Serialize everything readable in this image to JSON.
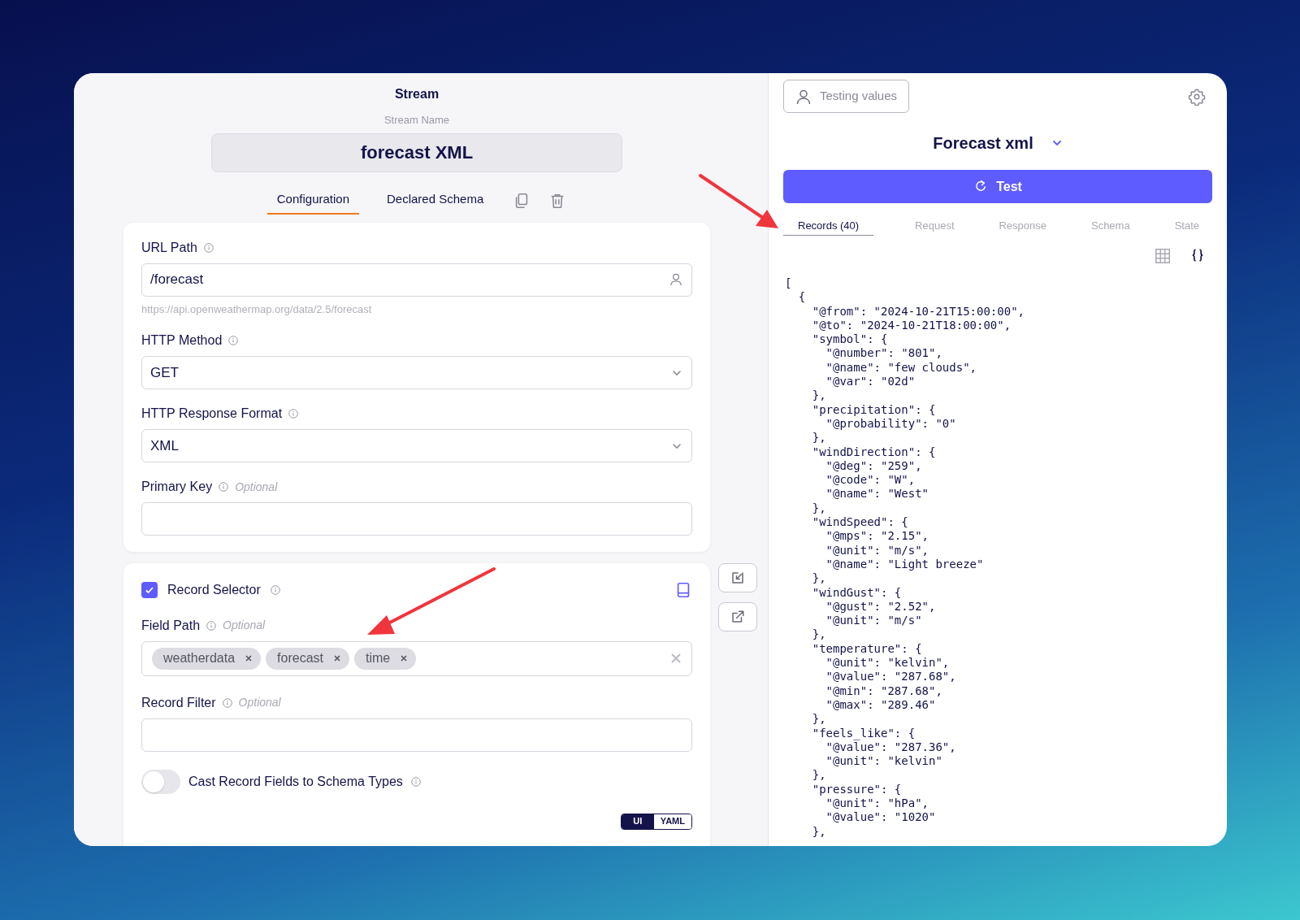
{
  "stream": {
    "heading": "Stream",
    "name_label": "Stream Name",
    "name": "forecast XML"
  },
  "tabs": [
    {
      "label": "Configuration",
      "selected": true
    },
    {
      "label": "Declared Schema",
      "selected": false
    }
  ],
  "config_fields": [
    {
      "kind": "text",
      "label": "URL Path",
      "value": "/forecast",
      "hint": "https://api.openweathermap.org/data/2.5/forecast"
    },
    {
      "kind": "select",
      "label": "HTTP Method",
      "value": "GET"
    },
    {
      "kind": "select",
      "label": "HTTP Response Format",
      "value": "XML"
    },
    {
      "kind": "text",
      "label": "Primary Key",
      "optional": "Optional"
    }
  ],
  "record_selector": {
    "label": "Record Selector",
    "checked": true,
    "field_path": {
      "label": "Field Path",
      "optional": "Optional",
      "tags": [
        "weatherdata",
        "forecast",
        "time"
      ]
    },
    "record_filter": {
      "label": "Record Filter",
      "optional": "Optional"
    },
    "cast_toggle": {
      "label": "Cast Record Fields to Schema Types",
      "on": false
    },
    "mode_switch": [
      {
        "label": "UI",
        "selected": true
      },
      {
        "label": "YAML",
        "selected": false
      }
    ]
  },
  "testing_values_button": "Testing values",
  "stream_selector": "Forecast xml",
  "test_button": "Test",
  "result_tabs": [
    {
      "label": "Records (40)",
      "selected": true
    },
    {
      "label": "Request",
      "selected": false
    },
    {
      "label": "Response",
      "selected": false
    },
    {
      "label": "Schema",
      "selected": false
    },
    {
      "label": "State",
      "selected": false
    }
  ],
  "view_modes": [
    {
      "kind": "table",
      "selected": false
    },
    {
      "kind": "json",
      "selected": true
    }
  ],
  "records_json": [
    "[",
    "  {",
    "    \"@from\": \"2024-10-21T15:00:00\",",
    "    \"@to\": \"2024-10-21T18:00:00\",",
    "    \"symbol\": {",
    "      \"@number\": \"801\",",
    "      \"@name\": \"few clouds\",",
    "      \"@var\": \"02d\"",
    "    },",
    "    \"precipitation\": {",
    "      \"@probability\": \"0\"",
    "    },",
    "    \"windDirection\": {",
    "      \"@deg\": \"259\",",
    "      \"@code\": \"W\",",
    "      \"@name\": \"West\"",
    "    },",
    "    \"windSpeed\": {",
    "      \"@mps\": \"2.15\",",
    "      \"@unit\": \"m/s\",",
    "      \"@name\": \"Light breeze\"",
    "    },",
    "    \"windGust\": {",
    "      \"@gust\": \"2.52\",",
    "      \"@unit\": \"m/s\"",
    "    },",
    "    \"temperature\": {",
    "      \"@unit\": \"kelvin\",",
    "      \"@value\": \"287.68\",",
    "      \"@min\": \"287.68\",",
    "      \"@max\": \"289.46\"",
    "    },",
    "    \"feels_like\": {",
    "      \"@value\": \"287.36\",",
    "      \"@unit\": \"kelvin\"",
    "    },",
    "    \"pressure\": {",
    "      \"@unit\": \"hPa\",",
    "      \"@value\": \"1020\"",
    "    },"
  ]
}
